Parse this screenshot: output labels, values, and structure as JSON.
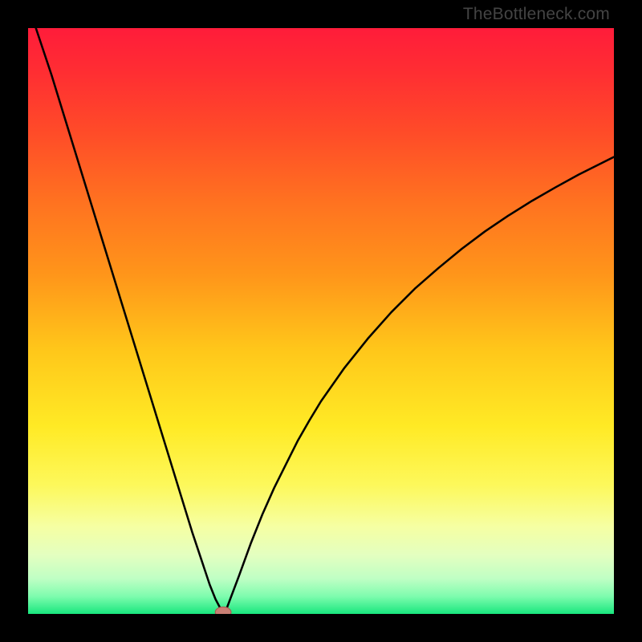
{
  "watermark": "TheBottleneck.com",
  "colors": {
    "frame": "#000000",
    "curve_stroke": "#000000",
    "marker_fill": "#c97f74",
    "marker_stroke": "#a85b50"
  },
  "chart_data": {
    "type": "line",
    "title": "",
    "xlabel": "",
    "ylabel": "",
    "xlim": [
      0,
      100
    ],
    "ylim": [
      0,
      100
    ],
    "gradient_stops": [
      {
        "offset": 0.0,
        "color": "#ff1c3a"
      },
      {
        "offset": 0.08,
        "color": "#ff2f32"
      },
      {
        "offset": 0.18,
        "color": "#ff4c28"
      },
      {
        "offset": 0.3,
        "color": "#ff7320"
      },
      {
        "offset": 0.42,
        "color": "#ff951a"
      },
      {
        "offset": 0.55,
        "color": "#ffc71a"
      },
      {
        "offset": 0.68,
        "color": "#ffea25"
      },
      {
        "offset": 0.78,
        "color": "#fdf85b"
      },
      {
        "offset": 0.85,
        "color": "#f6ffa2"
      },
      {
        "offset": 0.9,
        "color": "#e3ffc0"
      },
      {
        "offset": 0.94,
        "color": "#bfffc4"
      },
      {
        "offset": 0.97,
        "color": "#7efcae"
      },
      {
        "offset": 1.0,
        "color": "#19e77e"
      }
    ],
    "series": [
      {
        "name": "bottleneck-curve",
        "x": [
          0,
          2,
          4,
          6,
          8,
          10,
          12,
          14,
          16,
          18,
          20,
          22,
          24,
          26,
          28,
          30,
          31,
          32,
          32.9,
          33.3,
          34,
          36,
          38,
          40,
          42,
          44,
          46,
          48,
          50,
          54,
          58,
          62,
          66,
          70,
          74,
          78,
          82,
          86,
          90,
          94,
          98,
          100
        ],
        "y": [
          104,
          98,
          92,
          85.5,
          79,
          72.5,
          66,
          59.5,
          53,
          46.5,
          40,
          33.5,
          27,
          20.5,
          14,
          8,
          5,
          2.5,
          0.8,
          0.3,
          1.2,
          6.5,
          12,
          17,
          21.5,
          25.5,
          29.5,
          33,
          36.3,
          42,
          47,
          51.5,
          55.5,
          59,
          62.3,
          65.3,
          68,
          70.5,
          72.8,
          75,
          77,
          78
        ]
      }
    ],
    "marker": {
      "x": 33.3,
      "y": 0.3,
      "rx": 1.35,
      "ry": 0.9
    }
  }
}
